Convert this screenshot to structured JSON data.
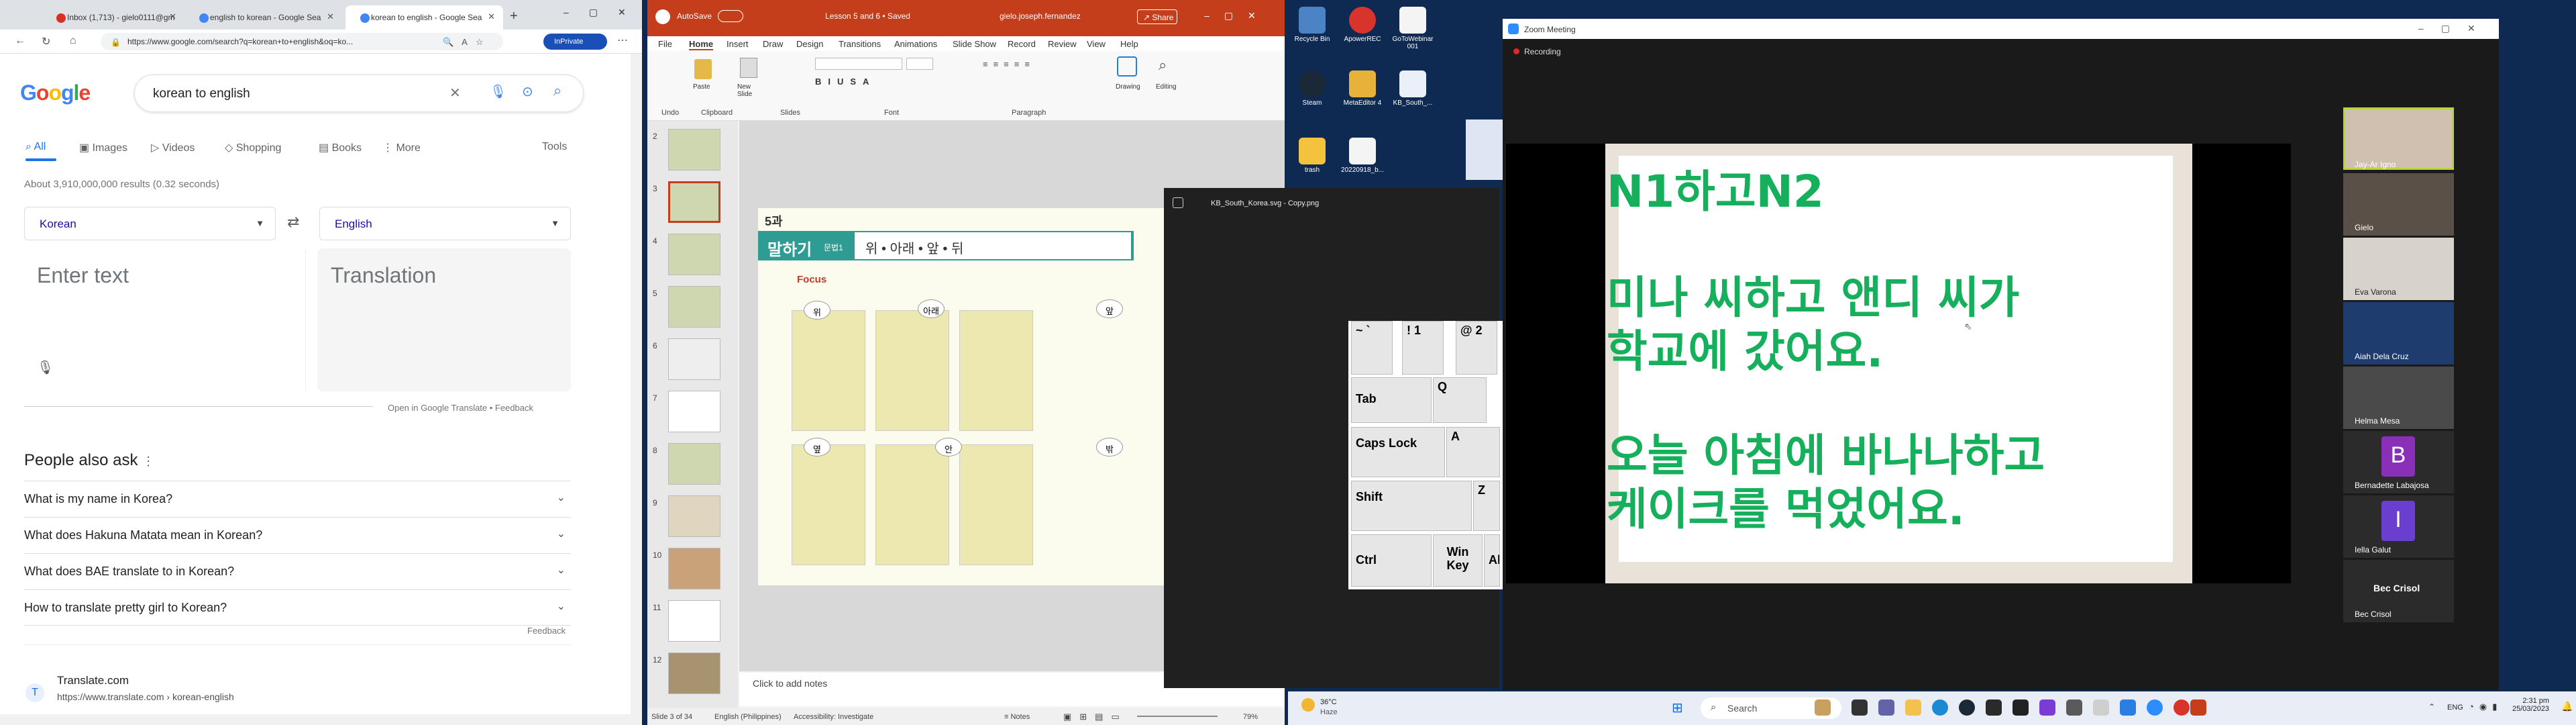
{
  "browser": {
    "tabs": [
      {
        "label": "Inbox (1,713) - gielo0111@gm",
        "color": "#d93025"
      },
      {
        "label": "english to korean - Google Sea",
        "color": "#4285f4"
      },
      {
        "label": "korean to english - Google Sea",
        "color": "#4285f4"
      }
    ],
    "address": "https://www.google.com/search?q=korean+to+english&oq=ko...",
    "private_label": "InPrivate",
    "logo": "Google",
    "query": "korean to english",
    "tabs_nav": [
      "All",
      "Images",
      "Videos",
      "Shopping",
      "Books",
      "More"
    ],
    "tools": "Tools",
    "stats": "About 3,910,000,000 results (0.32 seconds)",
    "source_lang": "Korean",
    "target_lang": "English",
    "source_placeholder": "Enter text",
    "target_placeholder": "Translation",
    "translate_links": "Open in Google Translate  •  Feedback",
    "paa_title": "People also ask",
    "paa": [
      "What is my name in Korea?",
      "What does Hakuna Matata mean in Korean?",
      "What does BAE translate to in Korean?",
      "How to translate pretty girl to Korean?"
    ],
    "paa_feedback": "Feedback",
    "result_name": "Translate.com",
    "result_url": "https://www.translate.com › korean-english"
  },
  "ppt": {
    "autosave": "AutoSave",
    "title": "Lesson 5 and 6 • Saved",
    "user": "gielo.joseph.fernandez",
    "share": "Share",
    "menu": [
      "File",
      "Home",
      "Insert",
      "Draw",
      "Design",
      "Transitions",
      "Animations",
      "Slide Show",
      "Record",
      "Review",
      "View",
      "Help"
    ],
    "groups": [
      "Undo",
      "Clipboard",
      "Slides",
      "Font",
      "Paragraph"
    ],
    "buttons": [
      "Paste",
      "New Slide",
      "Drawing",
      "Editing"
    ],
    "thumb_numbers": [
      "2",
      "3",
      "4",
      "5",
      "6",
      "7",
      "8",
      "9",
      "10",
      "11",
      "12"
    ],
    "slide_lesson": "5과",
    "slide_heading": "말하기",
    "slide_grammar": "문법1",
    "slide_words": "위 • 아래 • 앞 • 뒤",
    "slide_focus": "Focus",
    "slide_labels": [
      "위",
      "아래",
      "앞",
      "옆",
      "안",
      "밖"
    ],
    "notes": "Click to add notes",
    "status": "Slide 3 of 34",
    "language": "English (Philippines)",
    "accessibility": "Accessibility: Investigate",
    "notes_btn": "Notes",
    "zoom": "79%"
  },
  "viewer": {
    "title": "KB_South_Korea.svg - Copy.png"
  },
  "keyboard": {
    "keys": [
      "~ `",
      "! 1",
      "@ 2",
      "Tab",
      "Q",
      "Caps Lock",
      "A",
      "Shift",
      "Z",
      "Ctrl",
      "Win Key",
      "Alt"
    ]
  },
  "desktop": {
    "icons": [
      "Recycle Bin",
      "ApowerREC",
      "GoToWebinar 001",
      "Steam",
      "MetaEditor 4",
      "KB_South_...",
      "trash",
      "20220918_b..."
    ]
  },
  "zoom": {
    "title": "Zoom Meeting",
    "recording": "Recording",
    "lines": [
      "N1하고N2",
      "미나 씨하고 앤디 씨가",
      "학교에 갔어요.",
      "오늘 아침에 바나나하고",
      "케이크를 먹었어요."
    ],
    "participants": [
      "Jay-Ar Igno",
      "Gielo",
      "Eva Varona",
      "Aiah Dela Cruz",
      "Helma Mesa",
      "Bernadette Labajosa",
      "Iella Galut",
      "Bec Crisol"
    ],
    "initials": [
      "B",
      "I"
    ],
    "speaker_tile": "Bec Crisol"
  },
  "taskbar": {
    "weather_temp": "36°C",
    "weather_desc": "Haze",
    "search": "Search",
    "lang": "ENG",
    "time": "2:31 pm",
    "date": "25/03/2023"
  }
}
